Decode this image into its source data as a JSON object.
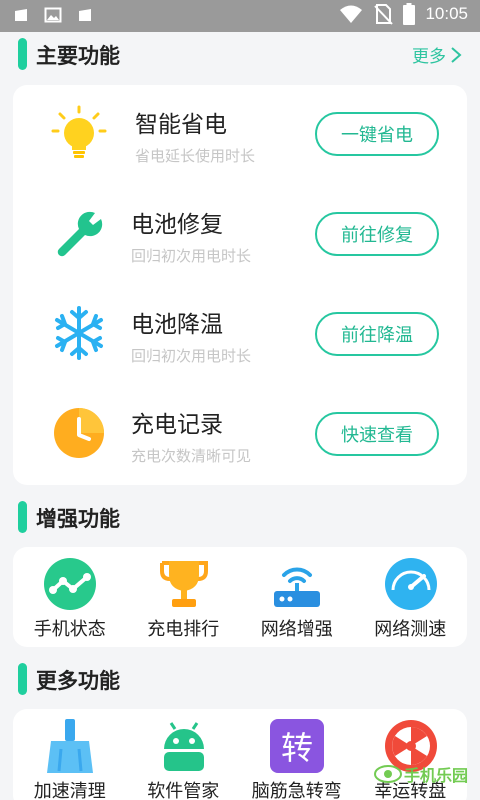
{
  "status_bar": {
    "time": "10:05",
    "left_icons": [
      "android-notification-icon",
      "image-notification-icon",
      "android-notification-icon"
    ],
    "right_icons": [
      "wifi-icon",
      "no-sim-icon",
      "battery-icon"
    ]
  },
  "main_section": {
    "title": "主要功能",
    "more_label": "更多",
    "items": [
      {
        "name": "智能省电",
        "sub": "省电延长使用时长",
        "button": "一键省电",
        "icon": "lightbulb-icon"
      },
      {
        "name": "电池修复",
        "sub": "回归初次用电时长",
        "button": "前往修复",
        "icon": "wrench-icon"
      },
      {
        "name": "电池降温",
        "sub": "回归初次用电时长",
        "button": "前往降温",
        "icon": "snowflake-icon"
      },
      {
        "name": "充电记录",
        "sub": "充电次数清晰可见",
        "button": "快速查看",
        "icon": "clock-icon"
      }
    ]
  },
  "enhance_section": {
    "title": "增强功能",
    "items": [
      {
        "label": "手机状态",
        "icon": "phone-status-icon"
      },
      {
        "label": "充电排行",
        "icon": "trophy-icon"
      },
      {
        "label": "网络增强",
        "icon": "router-icon"
      },
      {
        "label": "网络测速",
        "icon": "speedometer-icon"
      }
    ]
  },
  "more_section": {
    "title": "更多功能",
    "items": [
      {
        "label": "加速清理",
        "icon": "broom-icon"
      },
      {
        "label": "软件管家",
        "icon": "android-robot-icon"
      },
      {
        "label": "脑筋急转弯",
        "icon": "zhuan-text-icon",
        "icon_text": "转"
      },
      {
        "label": "幸运转盘",
        "icon": "lucky-wheel-icon"
      }
    ]
  },
  "watermark": {
    "text": "手机乐园"
  },
  "colors": {
    "accent": "#1fcf9e",
    "button_text": "#22b892",
    "sub_text": "#c6c6c6",
    "background": "#f4f5f7"
  }
}
